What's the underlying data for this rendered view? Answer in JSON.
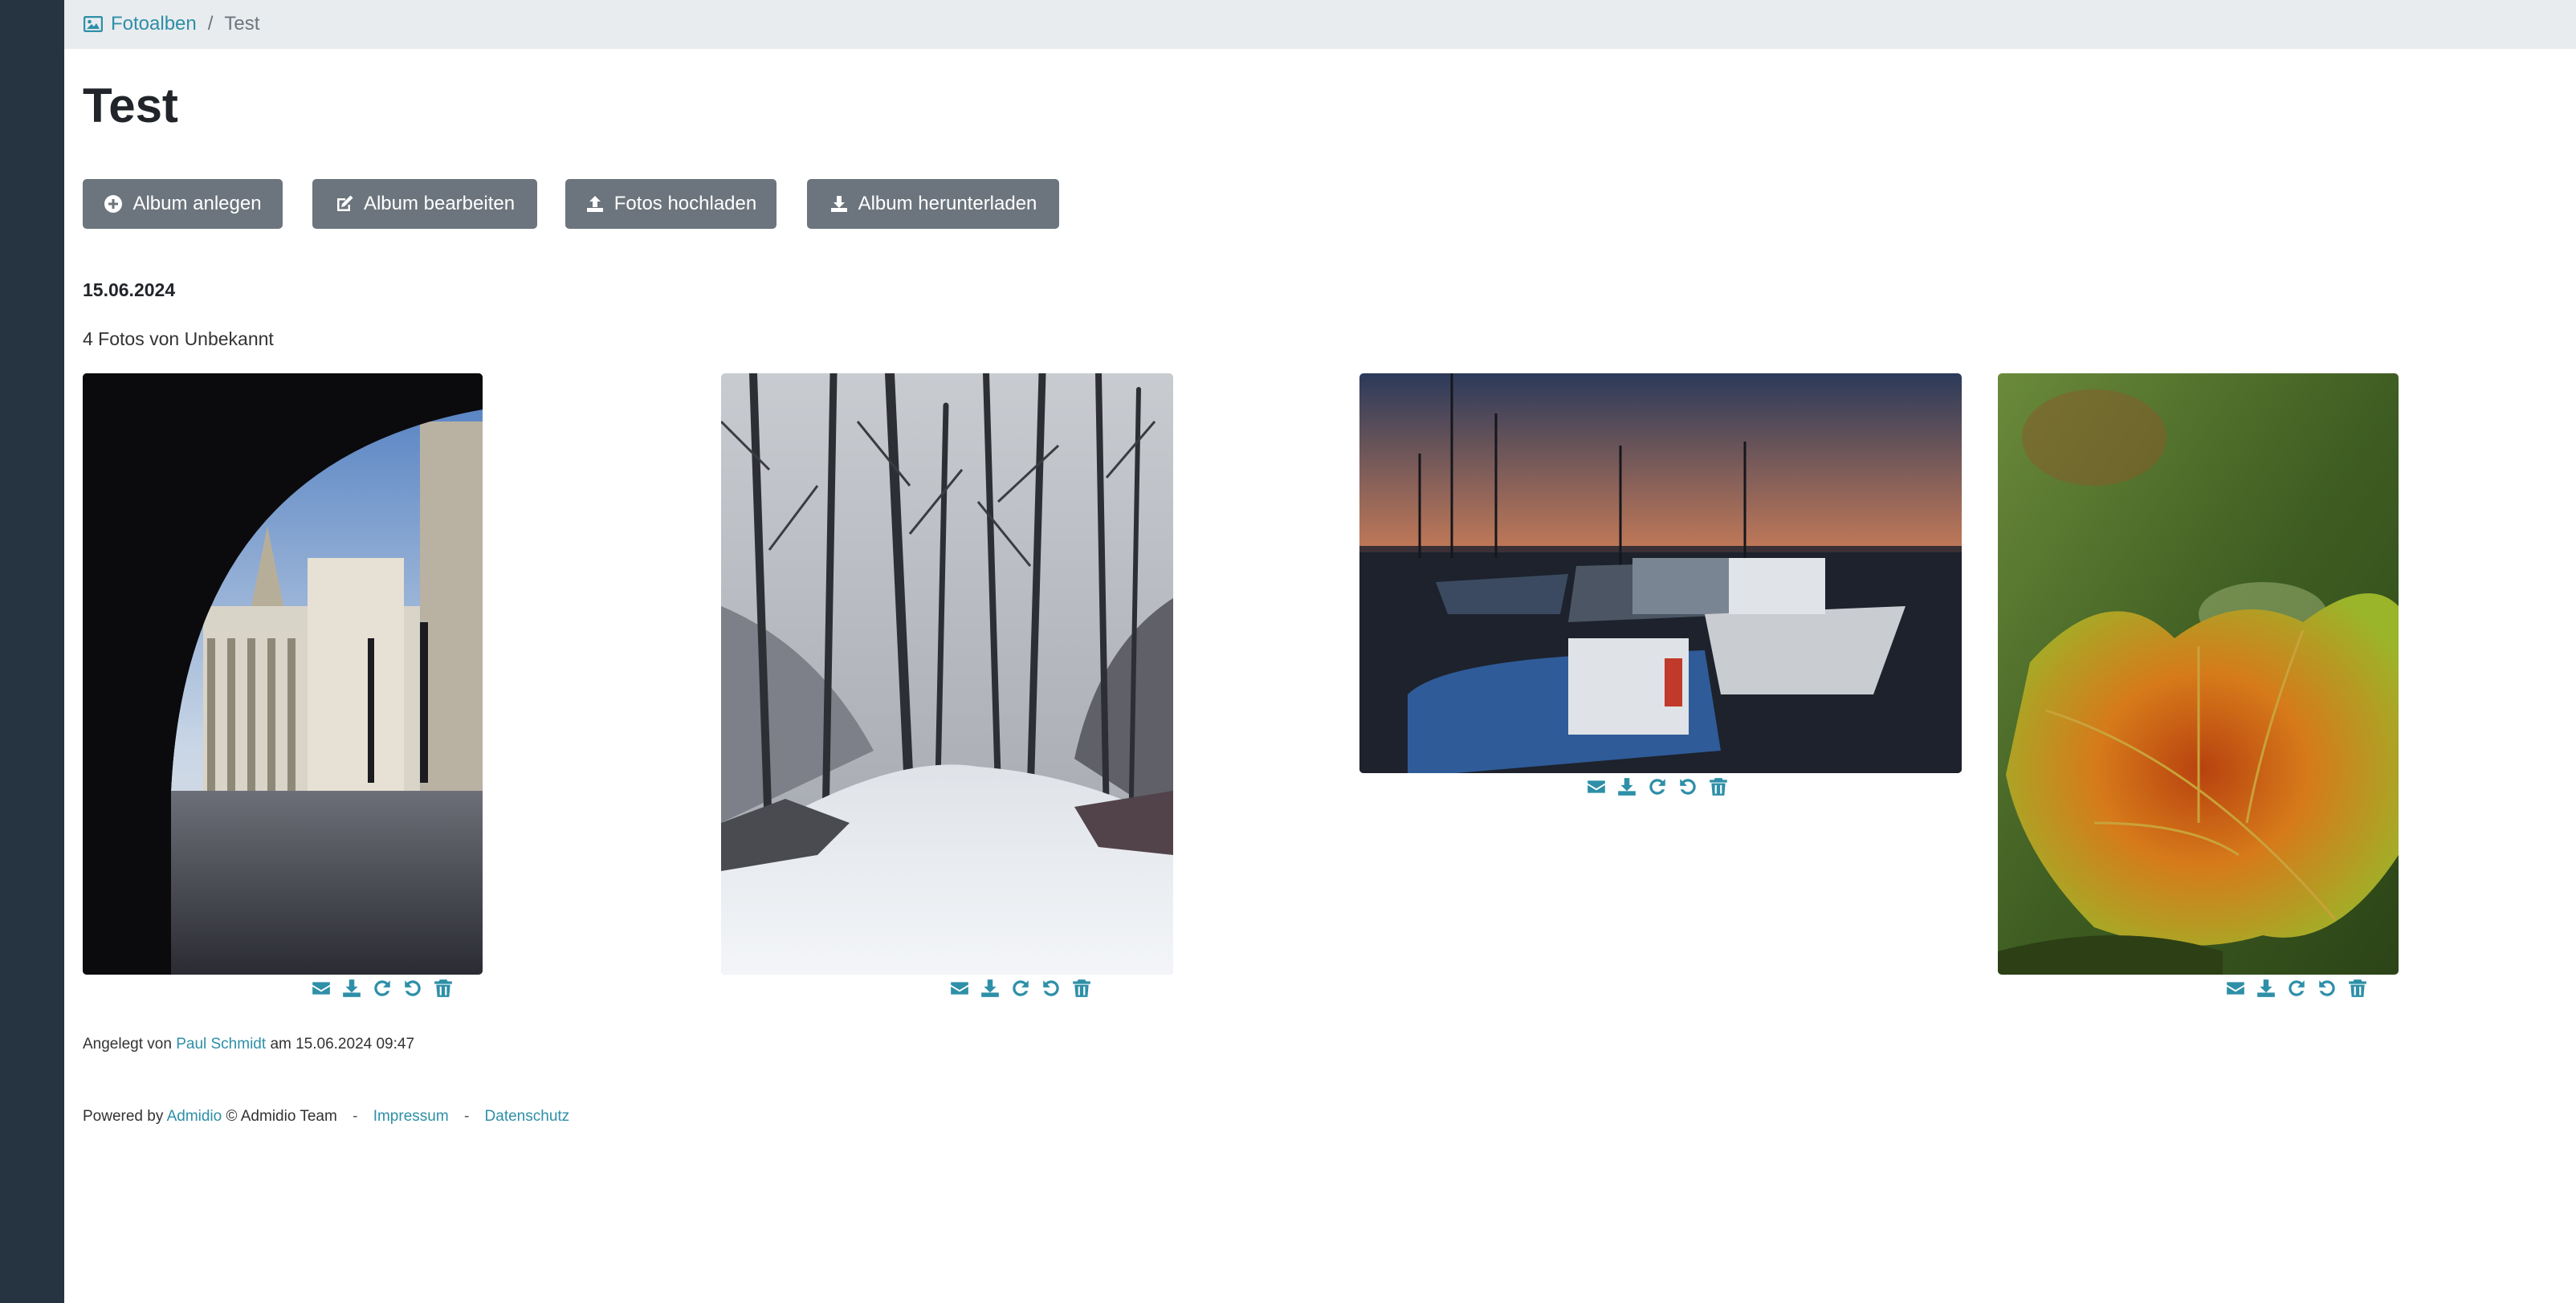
{
  "breadcrumb": {
    "parent_label": "Fotoalben",
    "separator": "/",
    "current_label": "Test",
    "parent_icon": "image-icon"
  },
  "page": {
    "title": "Test"
  },
  "toolbar": {
    "buttons": [
      {
        "label": "Album anlegen",
        "icon": "plus-circle-icon"
      },
      {
        "label": "Album bearbeiten",
        "icon": "edit-icon"
      },
      {
        "label": "Fotos hochladen",
        "icon": "upload-icon"
      },
      {
        "label": "Album herunterladen",
        "icon": "download-icon"
      }
    ]
  },
  "album": {
    "date": "15.06.2024",
    "photo_count_text": "4 Fotos von Unbekannt",
    "photos": [
      {
        "subject": "archway courtyard"
      },
      {
        "subject": "snowy forest path"
      },
      {
        "subject": "harbor sunset boats"
      },
      {
        "subject": "autumn leaf"
      }
    ],
    "photo_actions": [
      "envelope-icon",
      "download-icon",
      "rotate-right-icon",
      "rotate-left-icon",
      "trash-icon"
    ]
  },
  "created": {
    "prefix": "Angelegt von",
    "author": "Paul Schmidt",
    "suffix": "am 15.06.2024 09:47"
  },
  "footer": {
    "powered_by": "Powered by",
    "admidio_link": "Admidio",
    "team": "© Admidio Team",
    "separator": "-",
    "impressum": "Impressum",
    "datenschutz": "Datenschutz"
  },
  "colors": {
    "accent": "#2e8fa8",
    "button": "#6c757d",
    "sidebar": "#263340",
    "topbar": "#e9ecef"
  }
}
